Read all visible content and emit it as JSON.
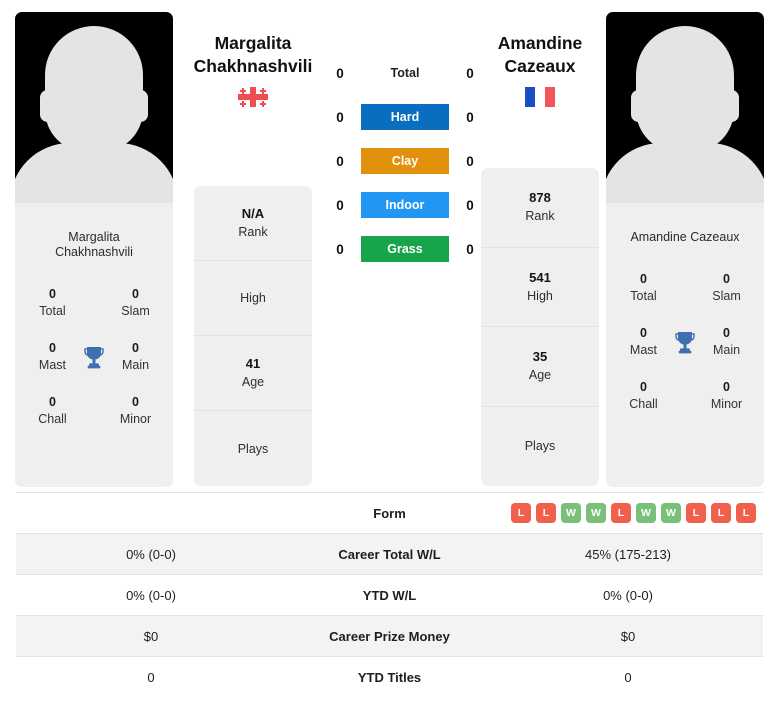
{
  "players": {
    "left": {
      "first_name": "Margalita",
      "last_name": "Chakhnashvili",
      "full_name_line1": "Margalita",
      "full_name_line2": "Chakhnashvili",
      "card_name_line1": "Margalita",
      "card_name_line2": "Chakhnashvili",
      "flag": "georgia-flag",
      "rank_value": "N/A",
      "rank_label": "Rank",
      "high_value": "",
      "high_label": "High",
      "age_value": "41",
      "age_label": "Age",
      "plays_value": "",
      "plays_label": "Plays",
      "titles": {
        "total_value": "0",
        "total_label": "Total",
        "slam_value": "0",
        "slam_label": "Slam",
        "mast_value": "0",
        "mast_label": "Mast",
        "main_value": "0",
        "main_label": "Main",
        "chall_value": "0",
        "chall_label": "Chall",
        "minor_value": "0",
        "minor_label": "Minor"
      }
    },
    "right": {
      "first_name": "Amandine",
      "last_name": "Cazeaux",
      "full_name_line1": "Amandine",
      "full_name_line2": "Cazeaux",
      "card_name_line1": "Amandine Cazeaux",
      "card_name_line2": "",
      "flag": "france-flag",
      "rank_value": "878",
      "rank_label": "Rank",
      "high_value": "541",
      "high_label": "High",
      "age_value": "35",
      "age_label": "Age",
      "plays_value": "",
      "plays_label": "Plays",
      "titles": {
        "total_value": "0",
        "total_label": "Total",
        "slam_value": "0",
        "slam_label": "Slam",
        "mast_value": "0",
        "mast_label": "Mast",
        "main_value": "0",
        "main_label": "Main",
        "chall_value": "0",
        "chall_label": "Chall",
        "minor_value": "0",
        "minor_label": "Minor"
      }
    }
  },
  "surfaces": [
    {
      "label": "Total",
      "left": "0",
      "right": "0",
      "color": "none",
      "plain": true
    },
    {
      "label": "Hard",
      "left": "0",
      "right": "0",
      "color": "#0a6ec0",
      "plain": false
    },
    {
      "label": "Clay",
      "left": "0",
      "right": "0",
      "color": "#e1910b",
      "plain": false
    },
    {
      "label": "Indoor",
      "left": "0",
      "right": "0",
      "color": "#2196f3",
      "plain": false
    },
    {
      "label": "Grass",
      "left": "0",
      "right": "0",
      "color": "#17a44a",
      "plain": false
    }
  ],
  "comparison_rows": [
    {
      "label": "Form",
      "left": "",
      "right": "",
      "type": "form"
    },
    {
      "label": "Career Total W/L",
      "left": "0% (0-0)",
      "right": "45% (175-213)",
      "type": "text"
    },
    {
      "label": "YTD W/L",
      "left": "0% (0-0)",
      "right": "0% (0-0)",
      "type": "text"
    },
    {
      "label": "Career Prize Money",
      "left": "$0",
      "right": "$0",
      "type": "text"
    },
    {
      "label": "YTD Titles",
      "left": "0",
      "right": "0",
      "type": "text"
    }
  ],
  "form": {
    "left": [],
    "right": [
      "L",
      "L",
      "W",
      "W",
      "L",
      "W",
      "W",
      "L",
      "L",
      "L"
    ]
  },
  "colors": {
    "win_badge": "#7ac07a",
    "loss_badge": "#f0604d",
    "hard": "#0a6ec0",
    "clay": "#e1910b",
    "indoor": "#2196f3",
    "grass": "#17a44a",
    "card_bg": "#efefef",
    "trophy": "#3f6fb0"
  },
  "icons": {
    "trophy": "trophy-icon",
    "avatar": "player-avatar-placeholder"
  }
}
